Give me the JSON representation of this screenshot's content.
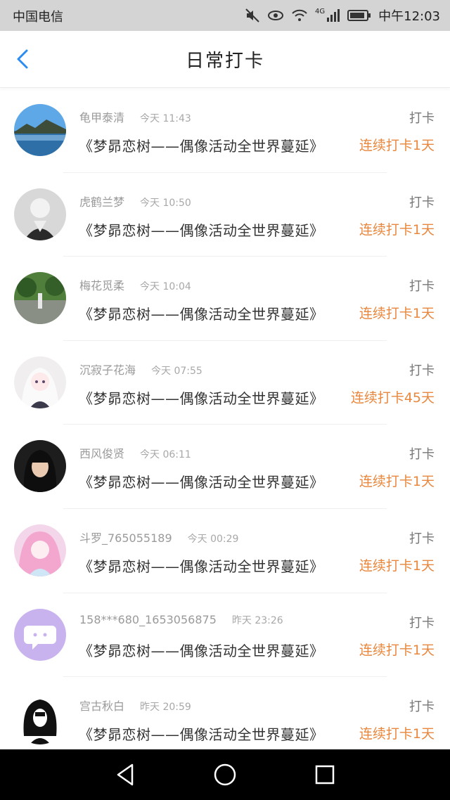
{
  "status_bar": {
    "carrier": "中国电信",
    "network": "4G",
    "time": "中午12:03"
  },
  "header": {
    "title": "日常打卡"
  },
  "records": [
    {
      "user": "龟甲泰清",
      "time": "今天 11:43",
      "type": "打卡",
      "activity": "《梦昴恋树——偶像活动全世界蔓延》",
      "streak": "连续打卡1天"
    },
    {
      "user": "虎鹤兰梦",
      "time": "今天 10:50",
      "type": "打卡",
      "activity": "《梦昴恋树——偶像活动全世界蔓延》",
      "streak": "连续打卡1天"
    },
    {
      "user": "梅花觅柔",
      "time": "今天 10:04",
      "type": "打卡",
      "activity": "《梦昴恋树——偶像活动全世界蔓延》",
      "streak": "连续打卡1天"
    },
    {
      "user": "沉寂子花海",
      "time": "今天 07:55",
      "type": "打卡",
      "activity": "《梦昴恋树——偶像活动全世界蔓延》",
      "streak": "连续打卡45天"
    },
    {
      "user": "西风俊贤",
      "time": "今天 06:11",
      "type": "打卡",
      "activity": "《梦昴恋树——偶像活动全世界蔓延》",
      "streak": "连续打卡1天"
    },
    {
      "user": "斗罗_765055189",
      "time": "今天 00:29",
      "type": "打卡",
      "activity": "《梦昴恋树——偶像活动全世界蔓延》",
      "streak": "连续打卡1天"
    },
    {
      "user": "158***680_1653056875",
      "time": "昨天 23:26",
      "type": "打卡",
      "activity": "《梦昴恋树——偶像活动全世界蔓延》",
      "streak": "连续打卡1天"
    },
    {
      "user": "宫古秋白",
      "time": "昨天 20:59",
      "type": "打卡",
      "activity": "《梦昴恋树——偶像活动全世界蔓延》",
      "streak": "连续打卡1天"
    }
  ],
  "colors": {
    "accent_back": "#2d8cf0",
    "streak": "#e8873d",
    "status_bar_bg": "#d4d4d4",
    "nav_bar_bg": "#000000"
  },
  "nav_bar": {
    "icons": [
      "back-triangle-icon",
      "home-circle-icon",
      "recents-square-icon"
    ]
  }
}
